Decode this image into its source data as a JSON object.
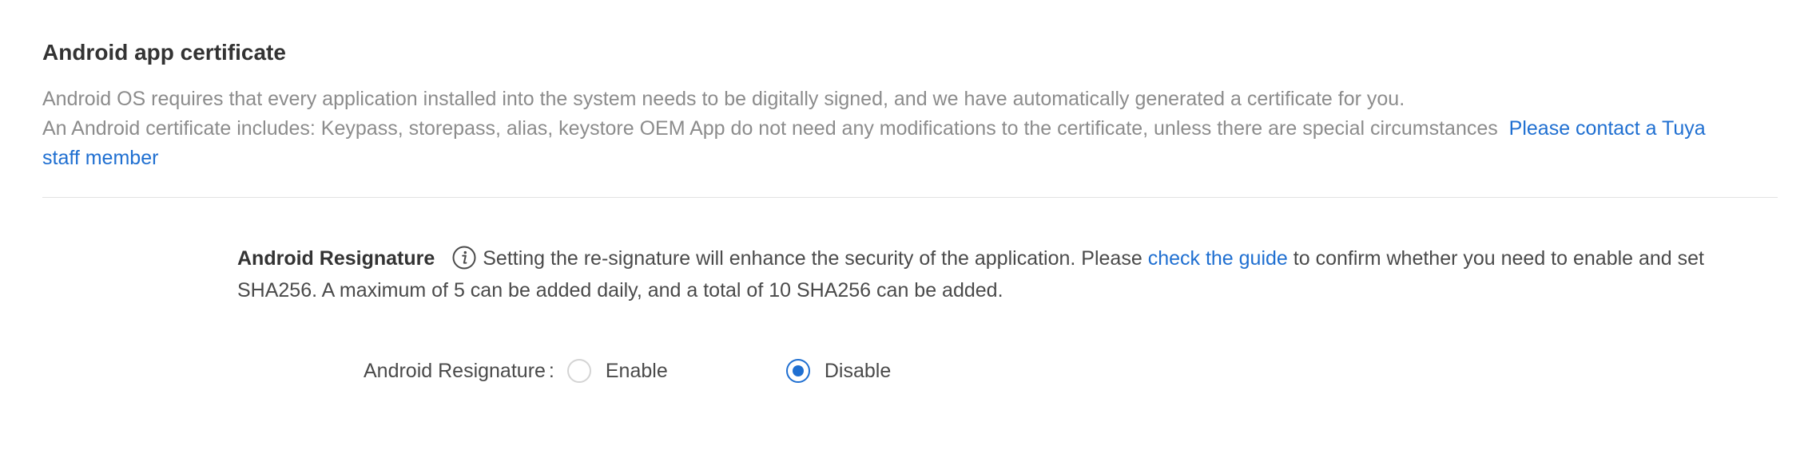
{
  "certificate": {
    "title": "Android app certificate",
    "desc_line1": "Android OS requires that every application installed into the system needs to be digitally signed, and we have automatically generated a certificate for you.",
    "desc_line2": "An Android certificate includes: Keypass, storepass, alias, keystore OEM App do not need any modifications to the certificate, unless there are special circumstances",
    "contact_link": "Please contact a Tuya staff member"
  },
  "resignature": {
    "heading": "Android Resignature",
    "info_icon": "info-icon",
    "text_before_link": "Setting the re-signature will enhance the security of the application. Please",
    "guide_link": "check the guide",
    "text_after_link": "to confirm whether you need to enable and set SHA256. A maximum of 5 can be added daily, and a total of 10 SHA256 can be added.",
    "form": {
      "label": "Android Resignature",
      "colon": ":",
      "options": [
        {
          "label": "Enable",
          "selected": false
        },
        {
          "label": "Disable",
          "selected": true
        }
      ]
    }
  },
  "colors": {
    "accent": "#1f6fd1",
    "muted_text": "#8c8c8c",
    "divider": "#e2e2e2"
  }
}
